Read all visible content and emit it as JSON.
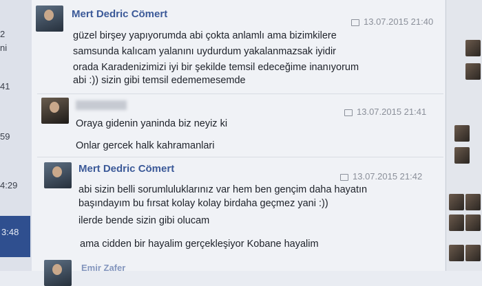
{
  "left_strip": {
    "items": [
      "2",
      "ni",
      "41",
      "59",
      "4:29",
      "3:48"
    ]
  },
  "messages": [
    {
      "sender": "Mert Dedric Cömert",
      "time": "13.07.2015 21:40",
      "lines": [
        "güzel birşey yapıyorumda abi çokta anlamlı ama bizimkilere",
        "samsunda kalıcam yalanını uydurdum yakalanmazsak iyidir",
        "orada Karadenizimizi iyi bir şekilde temsil edeceğime inanıyorum",
        "abi :)) sizin gibi temsil edememesemde"
      ]
    },
    {
      "sender": "",
      "time": "13.07.2015 21:41",
      "lines": [
        "Oraya gidenin yaninda biz neyiz ki",
        "Onlar gercek halk kahramanlari"
      ]
    },
    {
      "sender": "Mert Dedric Cömert",
      "time": "13.07.2015 21:42",
      "lines": [
        "abi sizin belli sorumluluklarınız var hem ben gençim daha hayatın",
        "başındayım bu fırsat kolay kolay birdaha geçmez yani :))",
        "ilerde bende sizin gibi olucam",
        "ama cidden bir hayalim gerçekleşiyor Kobane hayalim"
      ]
    },
    {
      "sender": "Emir Zafer",
      "time": ""
    }
  ]
}
